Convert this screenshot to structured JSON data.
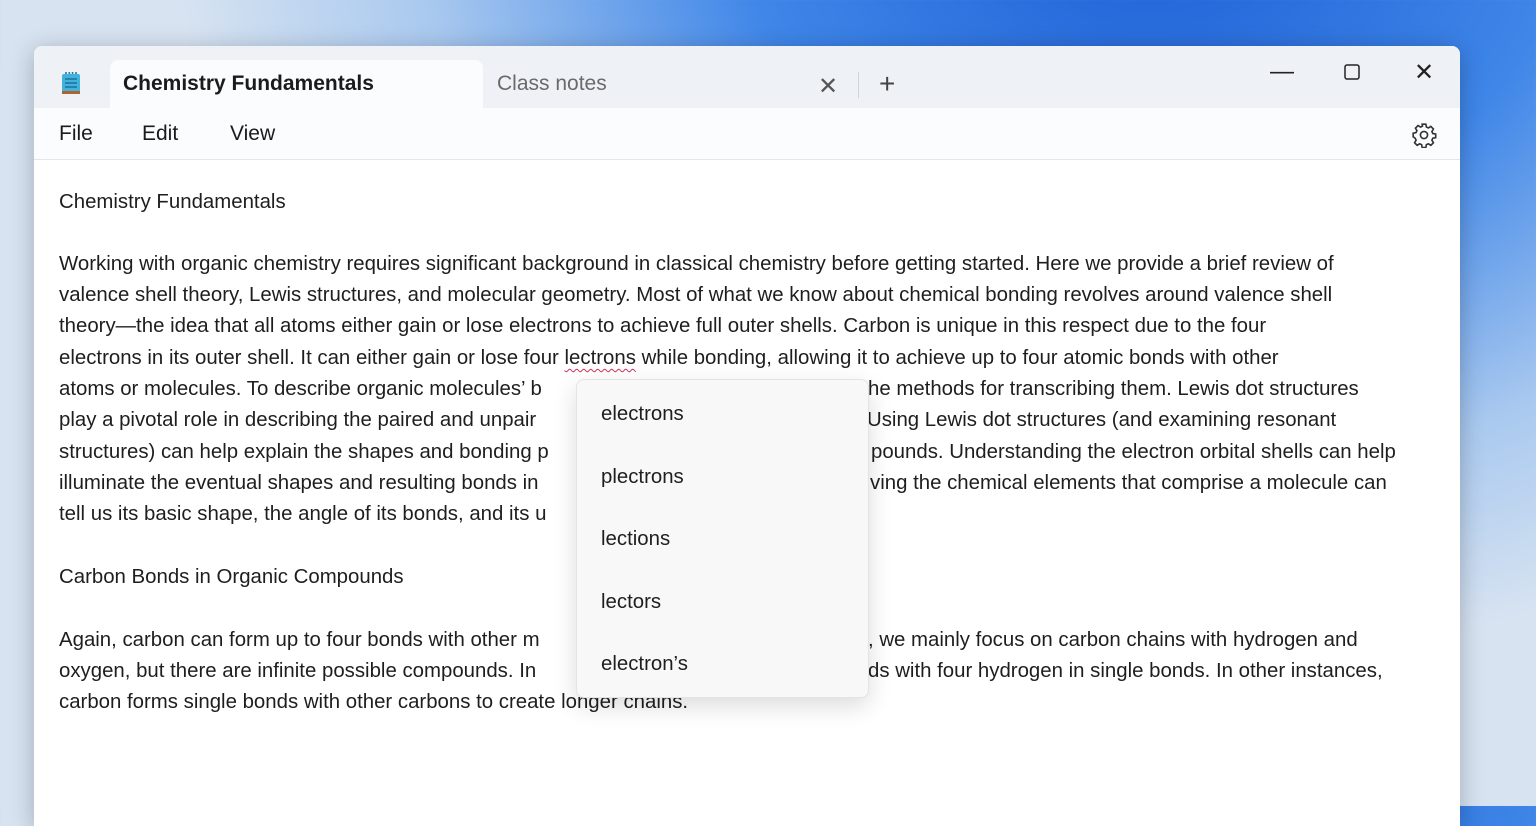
{
  "tabs": [
    {
      "label": "Chemistry Fundamentals",
      "active": true
    },
    {
      "label": "Class notes",
      "active": false
    }
  ],
  "window_controls": {
    "tab_close": "✕",
    "new_tab": "+",
    "minimize": "—",
    "maximize": "☐",
    "close": "✕"
  },
  "menu": [
    "File",
    "Edit",
    "View"
  ],
  "document": {
    "lines": [
      "Chemistry Fundamentals",
      "Working with organic chemistry requires significant background in classical chemistry before getting started. Here we provide a brief review of",
      "valence shell theory, Lewis structures, and molecular geometry. Most of what we know about chemical bonding revolves around valence shell",
      "theory—the idea that all atoms either gain or lose electrons to achieve full outer shells. Carbon is unique in this respect due to the four"
    ],
    "line4": {
      "before": "electrons in its outer shell. It can either gain or lose four ",
      "misspelled": "lectrons",
      "after": " while bonding, allowing it to achieve up to four atomic bonds with other"
    },
    "split_lines": [
      {
        "left": "atoms or molecules. To describe organic molecules’ b",
        "right": "he methods for transcribing them. Lewis dot structures"
      },
      {
        "left": "play a pivotal role in describing the paired and unpair",
        "right": "Using Lewis dot structures (and examining resonant"
      },
      {
        "left": "structures) can help explain the shapes and bonding p",
        "right": "pounds. Understanding the electron orbital shells can help"
      },
      {
        "left": "illuminate the eventual shapes and resulting bonds in",
        "right": "ving the chemical elements that comprise a molecule can"
      },
      {
        "left": "tell us its basic shape, the angle of its bonds, and its u",
        "right": ""
      }
    ],
    "heading2": "Carbon Bonds in Organic Compounds",
    "split_lines2": [
      {
        "left": "Again, carbon can form up to four bonds with other m",
        "right": ", we mainly focus on carbon chains with hydrogen and"
      },
      {
        "left": "oxygen, but there are infinite possible compounds. In",
        "right": "ds with four hydrogen in single bonds. In other instances,"
      }
    ],
    "last_line": "carbon forms single bonds with other carbons to create longer chains."
  },
  "spelling_suggestions": [
    "electrons",
    "plectrons",
    "lections",
    "lectors",
    "electron’s"
  ]
}
